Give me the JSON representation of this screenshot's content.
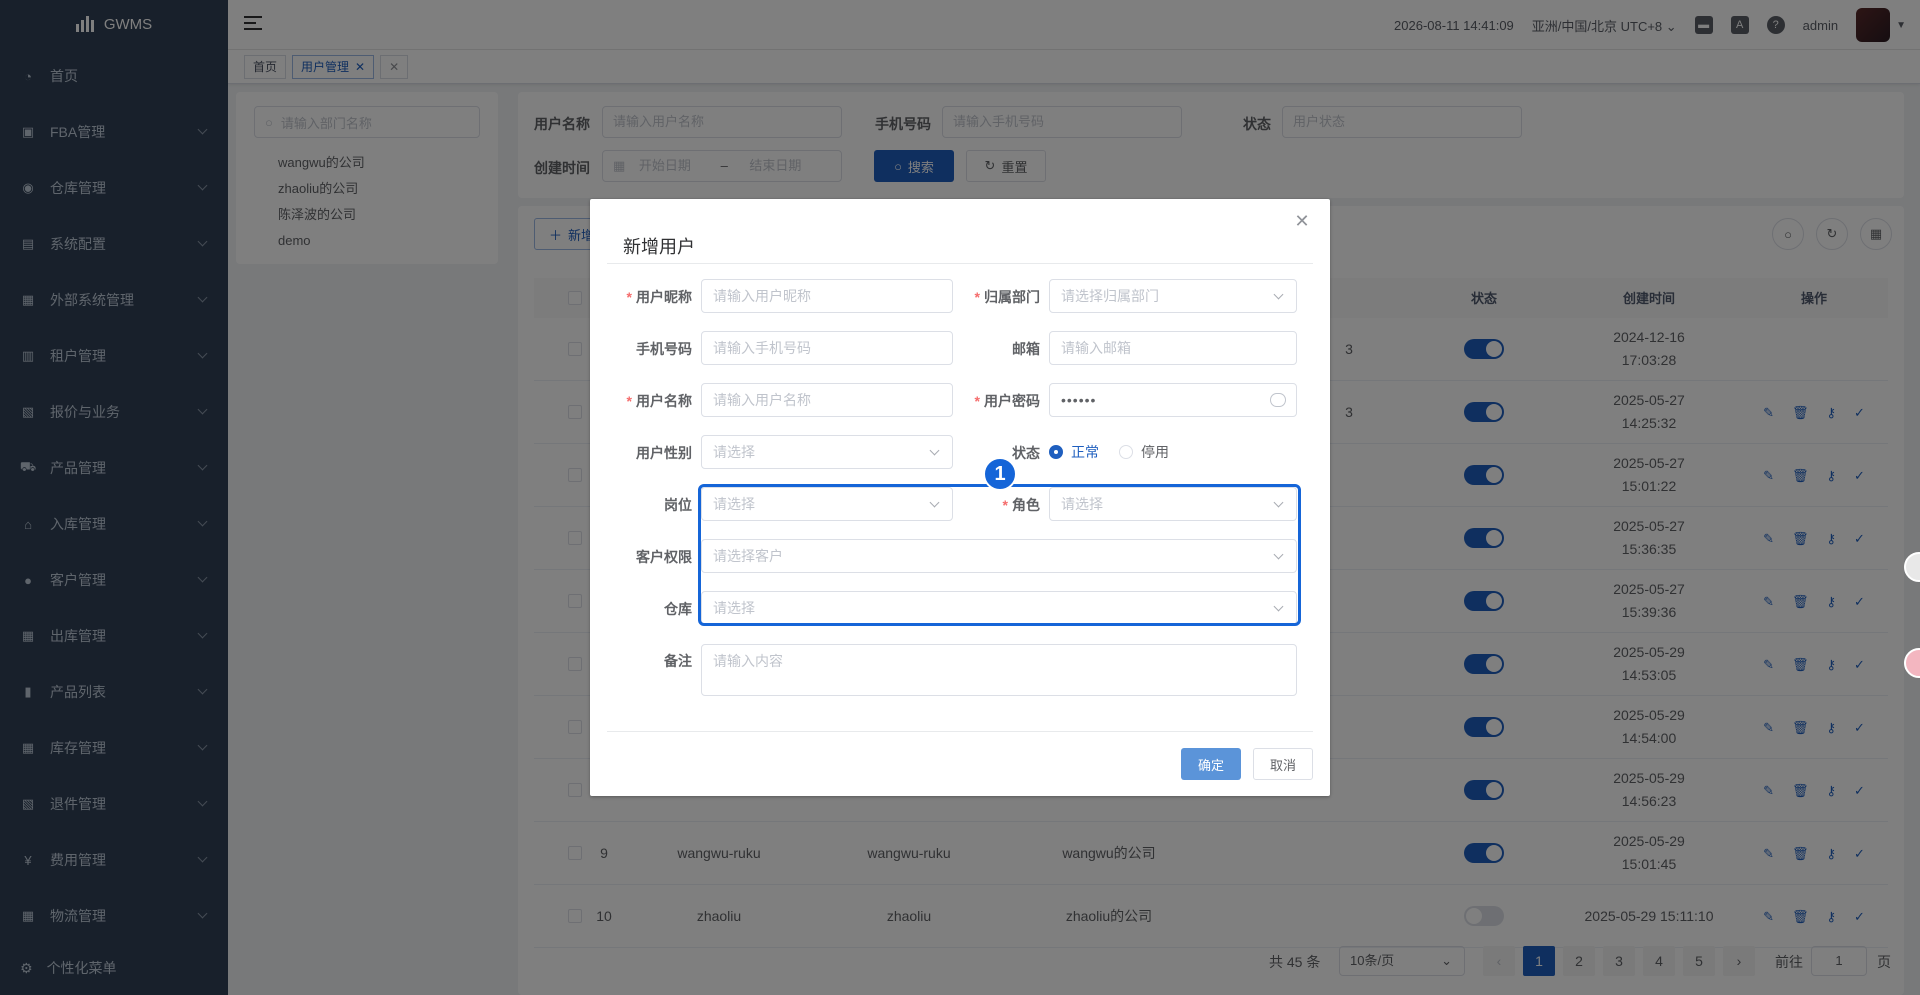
{
  "app": {
    "name": "GWMS"
  },
  "sidebar": {
    "items": [
      {
        "label": "首页",
        "icon": "dashboard-icon",
        "glyph": "◔",
        "chevron": false
      },
      {
        "label": "FBA管理",
        "icon": "box-icon",
        "glyph": "▣",
        "chevron": true
      },
      {
        "label": "仓库管理",
        "icon": "globe-icon",
        "glyph": "◉",
        "chevron": true
      },
      {
        "label": "系统配置",
        "icon": "server-icon",
        "glyph": "▤",
        "chevron": true
      },
      {
        "label": "外部系统管理",
        "icon": "grid-icon",
        "glyph": "▦",
        "chevron": true
      },
      {
        "label": "租户管理",
        "icon": "bar-chart-icon",
        "glyph": "▥",
        "chevron": true
      },
      {
        "label": "报价与业务",
        "icon": "form-icon",
        "glyph": "▧",
        "chevron": true
      },
      {
        "label": "产品管理",
        "icon": "cart-icon",
        "glyph": "⛟",
        "chevron": true
      },
      {
        "label": "入库管理",
        "icon": "home-icon",
        "glyph": "⌂",
        "chevron": true
      },
      {
        "label": "客户管理",
        "icon": "user-icon",
        "glyph": "●",
        "chevron": true
      },
      {
        "label": "出库管理",
        "icon": "grid-icon",
        "glyph": "▦",
        "chevron": true
      },
      {
        "label": "产品列表",
        "icon": "book-icon",
        "glyph": "▮",
        "chevron": true
      },
      {
        "label": "库存管理",
        "icon": "table-icon",
        "glyph": "▦",
        "chevron": true
      },
      {
        "label": "退件管理",
        "icon": "form-icon",
        "glyph": "▧",
        "chevron": true
      },
      {
        "label": "费用管理",
        "icon": "yen-icon",
        "glyph": "¥",
        "chevron": true
      },
      {
        "label": "物流管理",
        "icon": "grid-icon",
        "glyph": "▦",
        "chevron": true
      }
    ],
    "bottom": {
      "label": "个性化菜单",
      "glyph": "⚙"
    }
  },
  "header": {
    "datetime": "2026-08-11 14:41:09",
    "timezone": "亚洲/中国/北京 UTC+8",
    "user": "admin"
  },
  "tags": {
    "home": "首页",
    "current": "用户管理"
  },
  "dept": {
    "placeholder": "请输入部门名称",
    "items": [
      "wangwu的公司",
      "zhaoliu的公司",
      "陈泽波的公司",
      "demo"
    ]
  },
  "query": {
    "username_label": "用户名称",
    "username_ph": "请输入用户名称",
    "phone_label": "手机号码",
    "phone_ph": "请输入手机号码",
    "status_label": "状态",
    "status_ph": "用户状态",
    "created_label": "创建时间",
    "start_ph": "开始日期",
    "range_sep": "–",
    "end_ph": "结束日期",
    "search_btn": "搜索",
    "reset_btn": "重置",
    "add_btn": "新增"
  },
  "table": {
    "headers": {
      "status": "状态",
      "created": "创建时间",
      "actions": "操作"
    },
    "rows": [
      {
        "no": "",
        "user": "",
        "nick": "",
        "dept": "",
        "phone_tail": "3",
        "on": true,
        "created": "2024-12-16 17:03:28",
        "ops": false
      },
      {
        "no": "",
        "user": "",
        "nick": "",
        "dept": "",
        "phone_tail": "3",
        "on": true,
        "created": "2025-05-27 14:25:32",
        "ops": true
      },
      {
        "no": "",
        "user": "",
        "nick": "",
        "dept": "",
        "phone_tail": "",
        "on": true,
        "created": "2025-05-27 15:01:22",
        "ops": true
      },
      {
        "no": "",
        "user": "",
        "nick": "",
        "dept": "",
        "phone_tail": "",
        "on": true,
        "created": "2025-05-27 15:36:35",
        "ops": true
      },
      {
        "no": "",
        "user": "",
        "nick": "",
        "dept": "",
        "phone_tail": "",
        "on": true,
        "created": "2025-05-27 15:39:36",
        "ops": true
      },
      {
        "no": "",
        "user": "",
        "nick": "",
        "dept": "",
        "phone_tail": "",
        "on": true,
        "created": "2025-05-29 14:53:05",
        "ops": true
      },
      {
        "no": "",
        "user": "",
        "nick": "",
        "dept": "",
        "phone_tail": "",
        "on": true,
        "created": "2025-05-29 14:54:00",
        "ops": true
      },
      {
        "no": "",
        "user": "",
        "nick": "",
        "dept": "",
        "phone_tail": "",
        "on": true,
        "created": "2025-05-29 14:56:23",
        "ops": true
      },
      {
        "no": "9",
        "user": "wangwu-ruku",
        "nick": "wangwu-ruku",
        "dept": "wangwu的公司",
        "phone_tail": "",
        "on": true,
        "created": "2025-05-29 15:01:45",
        "ops": true
      },
      {
        "no": "10",
        "user": "zhaoliu",
        "nick": "zhaoliu",
        "dept": "zhaoliu的公司",
        "phone_tail": "",
        "on": false,
        "created": "2025-05-29 15:11:10",
        "ops": true
      }
    ]
  },
  "pagination": {
    "total": "共 45 条",
    "page_size": "10条/页",
    "pages": [
      "1",
      "2",
      "3",
      "4",
      "5"
    ],
    "current": "1",
    "goto_label": "前往",
    "goto_value": "1",
    "page_suffix": "页"
  },
  "dialog": {
    "title": "新增用户",
    "nickname_label": "用户昵称",
    "nickname_ph": "请输入用户昵称",
    "dept_label": "归属部门",
    "dept_ph": "请选择归属部门",
    "phone_label": "手机号码",
    "phone_ph": "请输入手机号码",
    "email_label": "邮箱",
    "email_ph": "请输入邮箱",
    "username_label": "用户名称",
    "username_ph": "请输入用户名称",
    "password_label": "用户密码",
    "password_value": "••••••",
    "gender_label": "用户性别",
    "gender_ph": "请选择",
    "status_label": "状态",
    "status_normal": "正常",
    "status_disabled": "停用",
    "post_label": "岗位",
    "post_ph": "请选择",
    "role_label": "角色",
    "role_ph": "请选择",
    "customer_label": "客户权限",
    "customer_ph": "请选择客户",
    "warehouse_label": "仓库",
    "warehouse_ph": "请选择",
    "remark_label": "备注",
    "remark_ph": "请输入内容",
    "ok_btn": "确定",
    "cancel_btn": "取消"
  },
  "annotation": {
    "step": "1"
  }
}
